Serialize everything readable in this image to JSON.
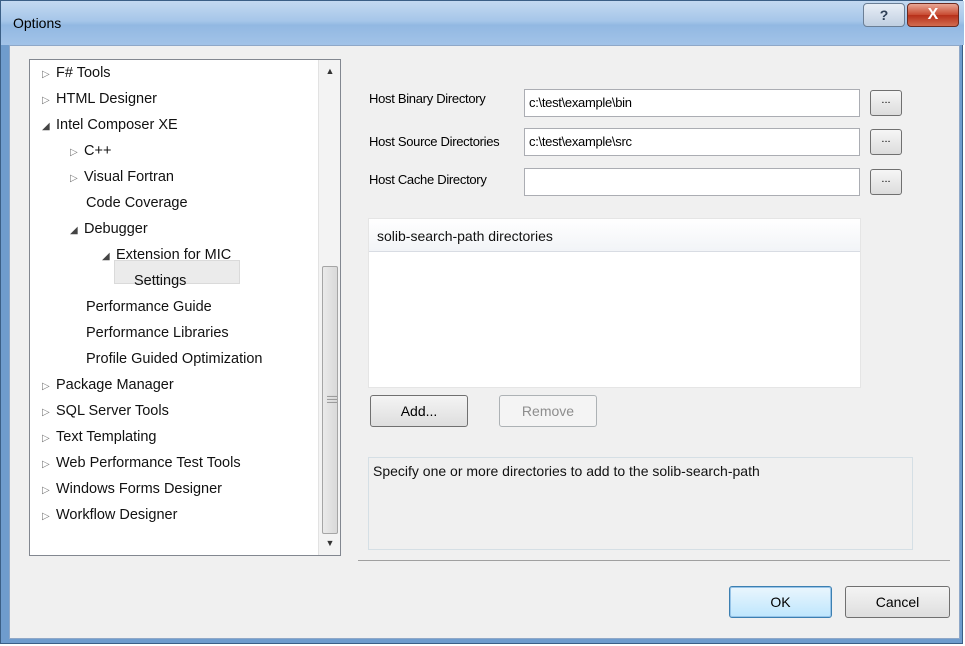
{
  "window": {
    "title": "Options",
    "help_label": "?",
    "close_label": "X"
  },
  "tree": {
    "items": [
      {
        "label": "F# Tools",
        "arrow": "▷"
      },
      {
        "label": "HTML Designer",
        "arrow": "▷"
      },
      {
        "label": "Intel Composer XE",
        "arrow": "◢"
      },
      {
        "label": "C++",
        "arrow": "▷"
      },
      {
        "label": "Visual Fortran",
        "arrow": "▷"
      },
      {
        "label": "Code Coverage",
        "arrow": ""
      },
      {
        "label": "Debugger",
        "arrow": "◢"
      },
      {
        "label": "Extension for MIC",
        "arrow": "◢"
      },
      {
        "label": "Settings",
        "arrow": ""
      },
      {
        "label": "Performance Guide",
        "arrow": ""
      },
      {
        "label": "Performance Libraries",
        "arrow": ""
      },
      {
        "label": "Profile Guided Optimization",
        "arrow": ""
      },
      {
        "label": "Package Manager",
        "arrow": "▷"
      },
      {
        "label": "SQL Server Tools",
        "arrow": "▷"
      },
      {
        "label": "Text Templating",
        "arrow": "▷"
      },
      {
        "label": "Web Performance Test Tools",
        "arrow": "▷"
      },
      {
        "label": "Windows Forms Designer",
        "arrow": "▷"
      },
      {
        "label": "Workflow Designer",
        "arrow": "▷"
      }
    ],
    "selected": "Extension for MIC",
    "scroll_up": "▲",
    "scroll_down": "▼"
  },
  "fields": {
    "binary_label": "Host Binary Directory",
    "binary_value": "c:\\test\\example\\bin",
    "source_label": "Host Source Directories",
    "source_value": "c:\\test\\example\\src",
    "cache_label": "Host Cache Directory",
    "cache_value": "",
    "browse_label": "..."
  },
  "list": {
    "header": "solib-search-path directories",
    "rows": []
  },
  "buttons": {
    "add": "Add...",
    "remove": "Remove",
    "ok": "OK",
    "cancel": "Cancel"
  },
  "description": "Specify one or more directories to add to the solib-search-path",
  "colors": {
    "titlebar": "#a6c6e9",
    "close": "#c74a30",
    "client": "#f0f0f0"
  }
}
